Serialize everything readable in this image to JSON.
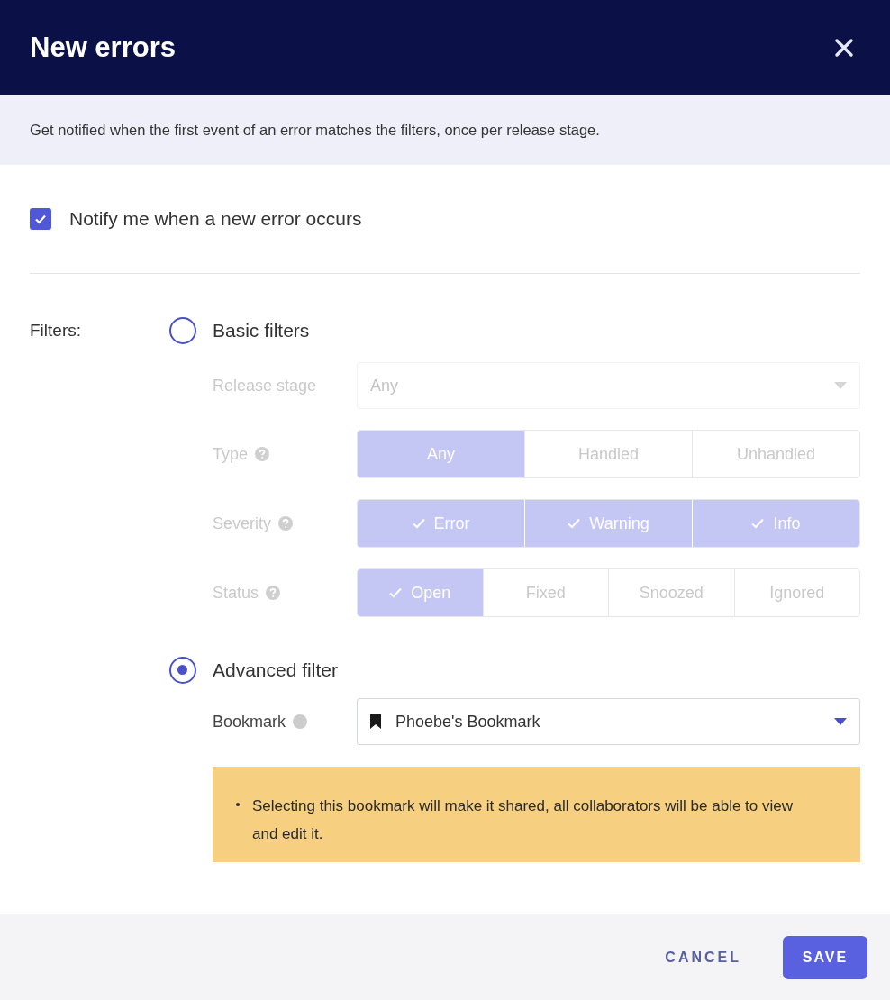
{
  "dialog": {
    "title": "New errors"
  },
  "description": "Get notified when the first event of an error matches the filters, once per release stage.",
  "notify": {
    "label": "Notify me when a new error occurs",
    "checked": true
  },
  "filters_label": "Filters:",
  "basic": {
    "label": "Basic filters",
    "selected": false,
    "disabled": true,
    "release_stage": {
      "label": "Release stage",
      "value": "Any"
    },
    "groups": [
      {
        "label": "Type",
        "kind": "single",
        "options": [
          {
            "label": "Any",
            "selected": true
          },
          {
            "label": "Handled",
            "selected": false
          },
          {
            "label": "Unhandled",
            "selected": false
          }
        ]
      },
      {
        "label": "Severity",
        "kind": "multi",
        "options": [
          {
            "label": "Error",
            "selected": true
          },
          {
            "label": "Warning",
            "selected": true
          },
          {
            "label": "Info",
            "selected": true
          }
        ]
      },
      {
        "label": "Status",
        "kind": "multi",
        "options": [
          {
            "label": "Open",
            "selected": true
          },
          {
            "label": "Fixed",
            "selected": false
          },
          {
            "label": "Snoozed",
            "selected": false
          },
          {
            "label": "Ignored",
            "selected": false
          }
        ]
      }
    ]
  },
  "advanced": {
    "label": "Advanced filter",
    "selected": true,
    "bookmark": {
      "label": "Bookmark",
      "value": "Phoebe's Bookmark"
    },
    "warning": "Selecting this bookmark will make it shared, all collaborators will be able to view and edit it."
  },
  "buttons": {
    "cancel": "CANCEL",
    "save": "SAVE"
  }
}
